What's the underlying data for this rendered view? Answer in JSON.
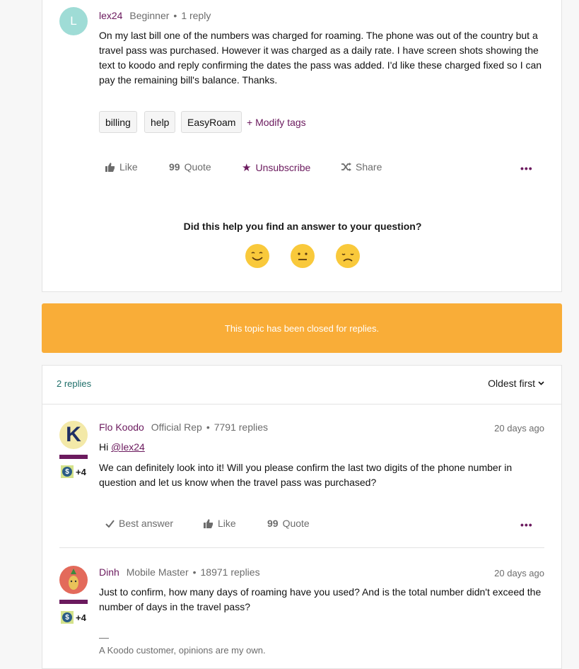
{
  "topic": {
    "avatar_letter": "L",
    "author": "lex24",
    "rank": "Beginner",
    "reply_count": "1 reply",
    "body": "On my last bill one of the numbers was charged for roaming. The phone was out of the country but a travel pass was purchased. However it was charged as a daily rate. I have screen shots showing the text to koodo and reply confirming the dates the pass was added. I'd like these charged fixed so I can pay the remaining bill's balance. Thanks.",
    "tags": [
      "billing",
      "help",
      "EasyRoam"
    ],
    "modify_tags": "+ Modify tags",
    "actions": {
      "like": "Like",
      "quote": "Quote",
      "unsubscribe": "Unsubscribe",
      "share": "Share",
      "more": "•••"
    },
    "feedback_question": "Did this help you find an answer to your question?"
  },
  "banner": {
    "text": "This topic has been closed for replies."
  },
  "replies_header": {
    "count": "2 replies",
    "sort": "Oldest first"
  },
  "replies": [
    {
      "author": "Flo Koodo",
      "rank": "Official Rep",
      "reply_count": "7791 replies",
      "date": "20 days ago",
      "badge_count": "+4",
      "mention_prefix": "Hi ",
      "mention": "@lex24",
      "body": "We can definitely look into it! Will you please confirm the last two digits of the phone number in question and let us know when the travel pass was purchased?",
      "actions": {
        "best_answer": "Best answer",
        "like": "Like",
        "quote": "Quote",
        "more": "•••"
      }
    },
    {
      "author": "Dinh",
      "rank": "Mobile Master",
      "reply_count": "18971 replies",
      "date": "20 days ago",
      "badge_count": "+4",
      "body": "Just to confirm, how many days of roaming have you used? And is the total number didn't exceed the number of days in the travel pass?",
      "signature_rule": "—",
      "signature": "A Koodo customer, opinions are my own."
    }
  ],
  "colors": {
    "accent": "#6b1a5e",
    "banner": "#f9ad38",
    "avatar_l": "#9fdcd6",
    "link_teal": "#1f6f6a"
  },
  "icons": [
    "thumbs-up-icon",
    "quote-icon",
    "star-icon",
    "shuffle-share-icon",
    "check-icon",
    "chevron-down-icon",
    "dollar-badge-icon",
    "happy-face-icon",
    "neutral-face-icon",
    "sad-face-icon"
  ]
}
